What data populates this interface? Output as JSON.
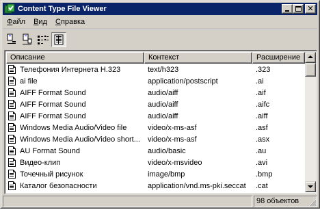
{
  "window": {
    "title": "Content Type File Viewer"
  },
  "menu": [
    {
      "label": "Файл"
    },
    {
      "label": "Вид"
    },
    {
      "label": "Справка"
    }
  ],
  "toolbar": {
    "buttons": [
      {
        "icon": "large-icons-view-icon"
      },
      {
        "icon": "small-icons-view-icon"
      },
      {
        "icon": "list-view-icon"
      },
      {
        "icon": "details-view-icon",
        "pressed": true
      }
    ]
  },
  "list": {
    "columns": [
      "Описание",
      "Контекст",
      "Расширение"
    ],
    "rows": [
      {
        "description": "Телефония Интернета H.323",
        "content_type": "text/h323",
        "extension": ".323"
      },
      {
        "description": "ai file",
        "content_type": "application/postscript",
        "extension": ".ai"
      },
      {
        "description": "AIFF Format Sound",
        "content_type": "audio/aiff",
        "extension": ".aif"
      },
      {
        "description": "AIFF Format Sound",
        "content_type": "audio/aiff",
        "extension": ".aifc"
      },
      {
        "description": "AIFF Format Sound",
        "content_type": "audio/aiff",
        "extension": ".aiff"
      },
      {
        "description": "Windows Media Audio/Video file",
        "content_type": "video/x-ms-asf",
        "extension": ".asf"
      },
      {
        "description": "Windows Media Audio/Video short...",
        "content_type": "video/x-ms-asf",
        "extension": ".asx"
      },
      {
        "description": "AU Format Sound",
        "content_type": "audio/basic",
        "extension": ".au"
      },
      {
        "description": "Видео-клип",
        "content_type": "video/x-msvideo",
        "extension": ".avi"
      },
      {
        "description": "Точечный рисунок",
        "content_type": "image/bmp",
        "extension": ".bmp"
      },
      {
        "description": "Каталог безопасности",
        "content_type": "application/vnd.ms-pki.seccat",
        "extension": ".cat"
      }
    ]
  },
  "status": {
    "main": "",
    "count": "98 объектов"
  },
  "colors": {
    "titlebar": "#0a246a",
    "face": "#d4d0c8",
    "window": "#ffffff"
  }
}
